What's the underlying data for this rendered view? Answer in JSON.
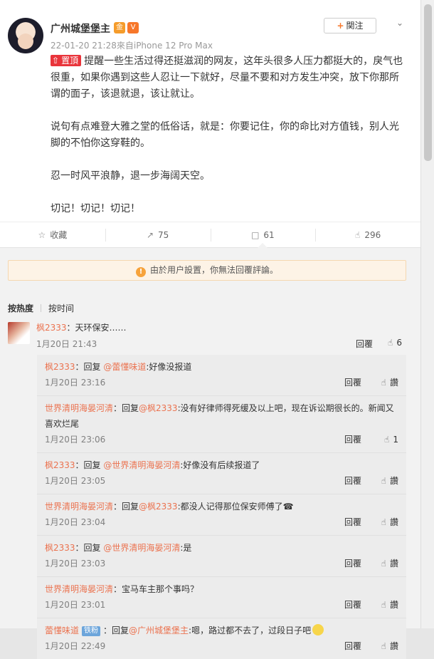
{
  "post": {
    "author": "广州城堡堡主",
    "badges": [
      "金",
      "V"
    ],
    "follow_label": "関注",
    "follow_plus": "+",
    "menu_icon": "chevron-down-icon",
    "meta": "22-01-20 21:28來自iPhone 12 Pro Max",
    "pin_label": "置頂",
    "paragraphs": [
      "提醒一些生活过得还挺滋润的网友，这年头很多人压力都挺大的，戾气也很重，如果你遇到这些人忍让一下就好，尽量不要和对方发生冲突，放下你那所谓的面子，该退就退，该让就让。",
      "说句有点难登大雅之堂的低俗话，就是：你要记住，你的命比对方值钱，别人光脚的不怕你这穿鞋的。",
      "忍一时风平浪静，退一步海阔天空。",
      "切记！切记！切记！"
    ]
  },
  "actions": {
    "favorite": {
      "label": "收藏",
      "icon": "star-icon"
    },
    "repost": {
      "label": "75",
      "icon": "repost-icon"
    },
    "comment": {
      "label": "61",
      "icon": "comment-icon"
    },
    "like": {
      "label": "296",
      "icon": "thumbs-up-icon"
    }
  },
  "notice": {
    "text": "由於用户設置，你無法回覆評論。",
    "icon": "!"
  },
  "sort": {
    "hot": "按热度",
    "time": "按时间"
  },
  "top_comment": {
    "user": "枫2333",
    "text": "：天环保安……",
    "time": "1月20日 21:43",
    "reply_label": "回覆",
    "likes": "6"
  },
  "replies": [
    {
      "user": "枫2333",
      "middle": "：回复 ",
      "target": "@蕾懂味道",
      "text": ":好像没报道",
      "time": "1月20日 23:16",
      "reply_label": "回覆",
      "like_label": "讚"
    },
    {
      "user": "世界清明海晏河清",
      "middle": "：回复",
      "target": "@枫2333",
      "text": ":没有好律师得死缓及以上吧，现在诉讼期很长的。新闻又喜欢烂尾",
      "time": "1月20日 23:06",
      "reply_label": "回覆",
      "like_label": "1"
    },
    {
      "user": "枫2333",
      "middle": "：回复 ",
      "target": "@世界清明海晏河清",
      "text": ":好像没有后续报道了",
      "time": "1月20日 23:05",
      "reply_label": "回覆",
      "like_label": "讚"
    },
    {
      "user": "世界清明海晏河清",
      "middle": "：回复",
      "target": "@枫2333",
      "text": ":都没人记得那位保安师傅了☎",
      "time": "1月20日 23:04",
      "reply_label": "回覆",
      "like_label": "讚"
    },
    {
      "user": "枫2333",
      "middle": "：回复 ",
      "target": "@世界清明海晏河清",
      "text": ":是",
      "time": "1月20日 23:03",
      "reply_label": "回覆",
      "like_label": "讚"
    },
    {
      "user": "世界清明海晏河清",
      "middle": "",
      "target": "",
      "text": "：宝马车主那个事吗？",
      "time": "1月20日 23:01",
      "reply_label": "回覆",
      "like_label": "讚"
    },
    {
      "user": "蕾懂味道",
      "fan": "铁粉",
      "middle": "：回复",
      "target": "@广州城堡堡主",
      "text": ":嗯，路过都不去了，过段日子吧",
      "time": "1月20日 22:49",
      "reply_label": "回覆",
      "like_label": "讚"
    }
  ]
}
